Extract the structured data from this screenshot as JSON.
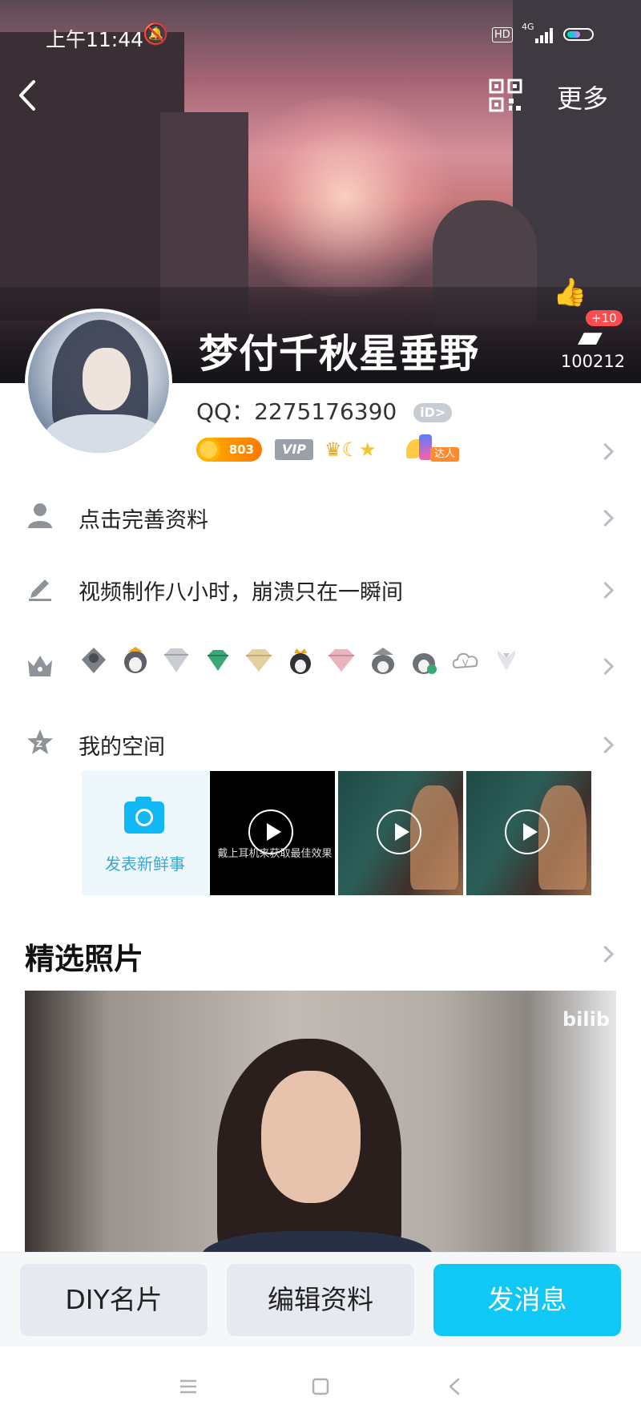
{
  "status_bar": {
    "time": "上午11:44",
    "hd": "HD",
    "network": "4G"
  },
  "header": {
    "more_label": "更多",
    "nickname": "梦付千秋星垂野",
    "likes_increment": "+10",
    "likes_count": "100212"
  },
  "profile": {
    "qq_label": "QQ：2275176390",
    "id_badge": "iD>",
    "level": "803",
    "vip_label": "VIP",
    "daren_tag": "达人"
  },
  "rows": {
    "complete_profile": "点击完善资料",
    "signature": "视频制作八小时，崩溃只在一瞬间",
    "my_space": "我的空间"
  },
  "space": {
    "post_new_label": "发表新鲜事",
    "video_hint": "戴上耳机来获取最佳效果"
  },
  "featured": {
    "title": "精选照片",
    "watermark": "bilib"
  },
  "actions": {
    "diy_card": "DIY名片",
    "edit_profile": "编辑资料",
    "send_message": "发消息"
  },
  "colors": {
    "accent": "#10c8f5",
    "level_badge": "#ff7a00",
    "chevron": "#b8bcc4"
  },
  "icons": [
    "back-icon",
    "qr-code-icon",
    "thumbs-up-icon",
    "person-icon",
    "pencil-icon",
    "crown-icon",
    "star-icon",
    "camera-icon",
    "play-icon"
  ]
}
